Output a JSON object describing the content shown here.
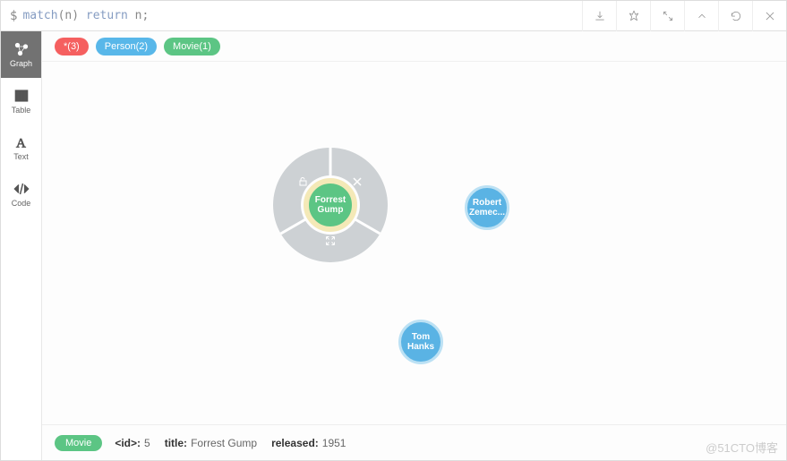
{
  "query": {
    "prompt": "$",
    "keyword1": "match",
    "paren_open": "(n) ",
    "keyword2": "return",
    "tail": " n;"
  },
  "sidebar": {
    "graph": "Graph",
    "table": "Table",
    "text": "Text",
    "code": "Code"
  },
  "chips": {
    "all": "*(3)",
    "person": "Person(2)",
    "movie": "Movie(1)"
  },
  "nodes": {
    "selected_movie": "Forrest\nGump",
    "person1": "Robert\nZemec...",
    "person2": "Tom\nHanks"
  },
  "footer": {
    "tag": "Movie",
    "id_key": "<id>:",
    "id_val": "5",
    "title_key": "title:",
    "title_val": "Forrest Gump",
    "released_key": "released:",
    "released_val": "1951"
  },
  "watermark": "@51CTO博客"
}
